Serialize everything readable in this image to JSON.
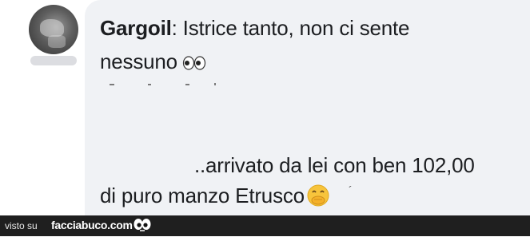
{
  "comment": {
    "author": "Gargoil",
    "line1": ": Istrice tanto, non ci sente",
    "line2": "nessuno",
    "line3": "..arrivato da lei con ben 102,00",
    "line4": "di puro manzo Etrusco"
  },
  "footer": {
    "seen_on": "visto su",
    "site": "facciabuco.com"
  },
  "icons": {
    "eyes": "eyes-emoji-icon",
    "face": "hand-over-mouth-emoji-icon",
    "logo": "facciabuco-eyes-icon"
  }
}
